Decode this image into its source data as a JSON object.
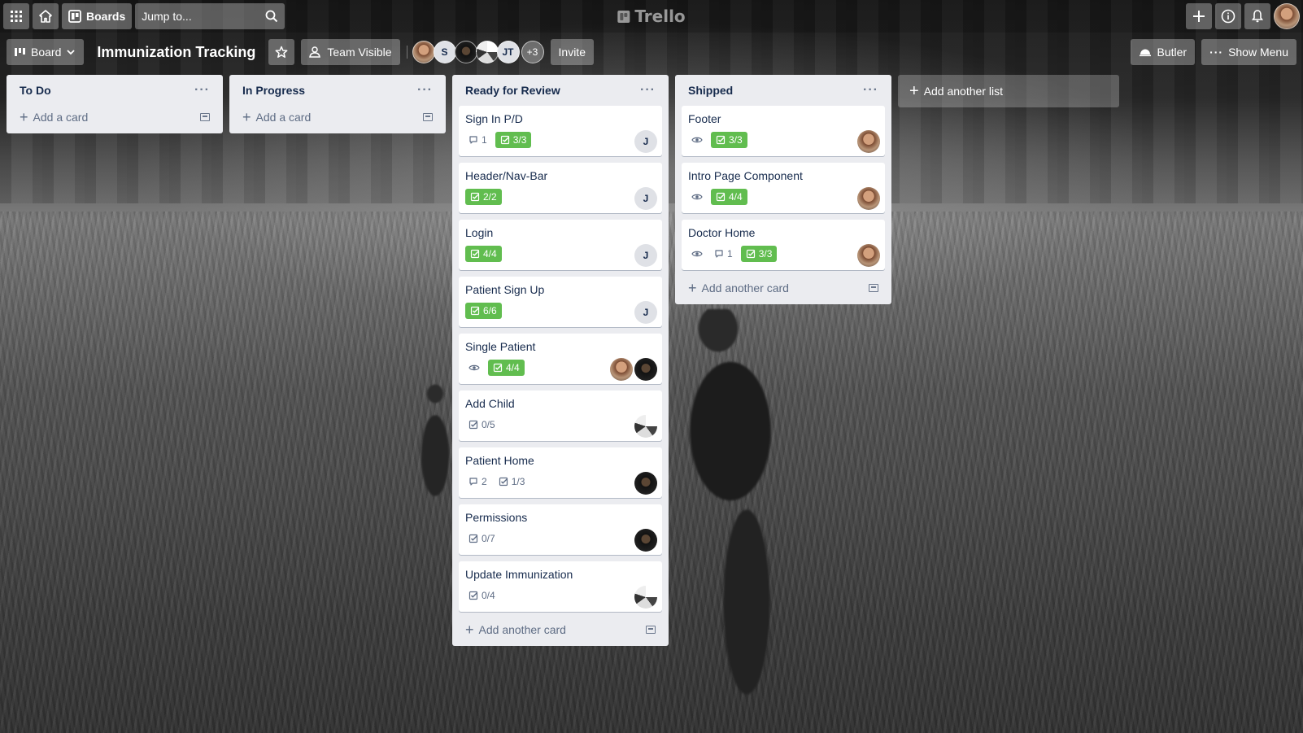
{
  "header": {
    "boards_label": "Boards",
    "search_placeholder": "Jump to...",
    "logo_text": "Trello"
  },
  "board": {
    "view_label": "Board",
    "title": "Immunization Tracking",
    "visibility_label": "Team Visible",
    "members": [
      "S",
      "JT"
    ],
    "members_more": "+3",
    "invite_label": "Invite",
    "butler_label": "Butler",
    "show_menu_label": "Show Menu"
  },
  "lists": [
    {
      "title": "To Do",
      "add_label": "Add a card",
      "cards": []
    },
    {
      "title": "In Progress",
      "add_label": "Add a card",
      "cards": []
    },
    {
      "title": "Ready for Review",
      "add_label": "Add another card",
      "cards": [
        {
          "title": "Sign In P/D",
          "comments": "1",
          "checklist": "3/3",
          "complete": true,
          "members": [
            "J"
          ]
        },
        {
          "title": "Header/Nav-Bar",
          "checklist": "2/2",
          "complete": true,
          "members": [
            "J"
          ]
        },
        {
          "title": "Login",
          "checklist": "4/4",
          "complete": true,
          "members": [
            "J"
          ]
        },
        {
          "title": "Patient Sign Up",
          "checklist": "6/6",
          "complete": true,
          "members": [
            "J"
          ]
        },
        {
          "title": "Single Patient",
          "watching": true,
          "checklist": "4/4",
          "complete": true,
          "members": [
            "photo1",
            "photo2"
          ]
        },
        {
          "title": "Add Child",
          "checklist": "0/5",
          "complete": false,
          "members": [
            "photo3"
          ]
        },
        {
          "title": "Patient Home",
          "comments": "2",
          "checklist": "1/3",
          "complete": false,
          "members": [
            "photo2"
          ]
        },
        {
          "title": "Permissions",
          "checklist": "0/7",
          "complete": false,
          "members": [
            "photo2"
          ]
        },
        {
          "title": "Update Immunization",
          "checklist": "0/4",
          "complete": false,
          "members": [
            "photo3"
          ]
        }
      ]
    },
    {
      "title": "Shipped",
      "add_label": "Add another card",
      "cards": [
        {
          "title": "Footer",
          "watching": true,
          "checklist": "3/3",
          "complete": true,
          "members": [
            "photo1"
          ]
        },
        {
          "title": "Intro Page Component",
          "watching": true,
          "checklist": "4/4",
          "complete": true,
          "members": [
            "photo1"
          ]
        },
        {
          "title": "Doctor Home",
          "watching": true,
          "comments": "1",
          "checklist": "3/3",
          "complete": true,
          "members": [
            "photo1"
          ]
        }
      ]
    }
  ],
  "add_list_label": "Add another list",
  "colors": {
    "complete_green": "#61bd4f",
    "list_bg": "#ebecf0"
  }
}
